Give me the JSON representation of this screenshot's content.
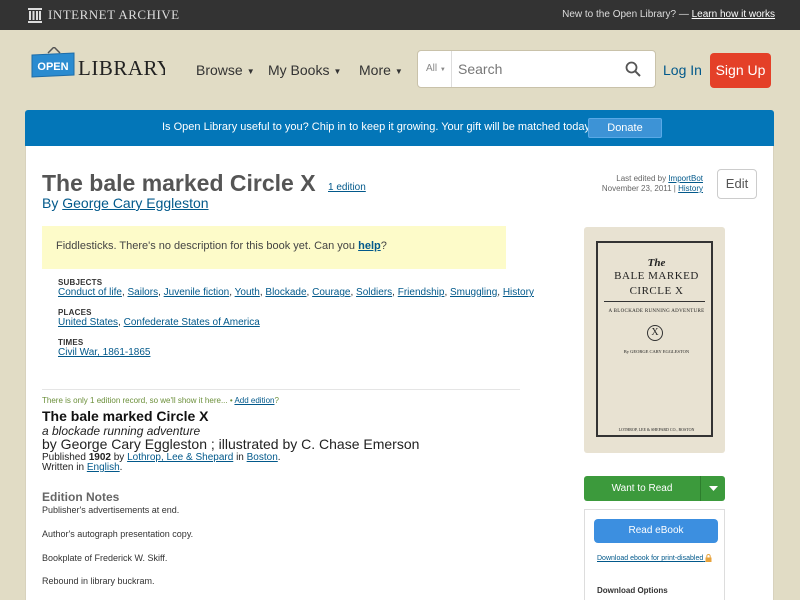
{
  "ia_bar": {
    "logo_text": "INTERNET ARCHIVE",
    "new_text": "New to the Open Library? — ",
    "learn_link": "Learn how it works"
  },
  "header": {
    "logo_open": "OPEN",
    "logo_library": "LIBRARY",
    "nav": [
      {
        "label": "Browse"
      },
      {
        "label": "My Books"
      },
      {
        "label": "More"
      }
    ],
    "search": {
      "category": "All",
      "placeholder": "Search"
    },
    "login": "Log In",
    "signup": "Sign Up"
  },
  "banner": {
    "text": "Is Open Library useful to you? Chip in to keep it growing. Your gift will be matched today!",
    "donate": "Donate"
  },
  "book": {
    "title": "The bale marked Circle X",
    "edition_count": "1 edition",
    "by": "By",
    "author": "George Cary Eggleston",
    "last_edited_label": "Last edited by",
    "last_edited_by": "ImportBot",
    "last_edited_date": "November 23, 2011",
    "history": "History",
    "edit": "Edit"
  },
  "description": {
    "text": "Fiddlesticks. There's no description for this book yet. Can you ",
    "help": "help",
    "end": "?"
  },
  "subjects": {
    "label": "SUBJECTS",
    "items": [
      "Conduct of life",
      "Sailors",
      "Juvenile fiction",
      "Youth",
      "Blockade",
      "Courage",
      "Soldiers",
      "Friendship",
      "Smuggling",
      "History"
    ]
  },
  "places": {
    "label": "PLACES",
    "items": [
      "United States",
      "Confederate States of America"
    ]
  },
  "times": {
    "label": "TIMES",
    "items": [
      "Civil War, 1861-1865"
    ]
  },
  "edition": {
    "only_one": "There is only 1 edition record, so we'll show it here...",
    "add_edition": "Add edition",
    "title": "The bale marked Circle X",
    "subtitle": "a blockade running adventure",
    "by_line": "by George Cary Eggleston ; illustrated by C. Chase Emerson",
    "published_label": "Published",
    "year": "1902",
    "by": "by",
    "publisher": "Lothrop, Lee & Shepard",
    "in": "in",
    "place": "Boston",
    "written_in_label": "Written in",
    "language": "English"
  },
  "notes": {
    "heading": "Edition Notes",
    "items": [
      "Publisher's advertisements at end.",
      "Author's autograph presentation copy.",
      "Bookplate of Frederick W. Skiff.",
      "Rebound in library buckram."
    ]
  },
  "cover": {
    "the": "The",
    "line1": "BALE MARKED",
    "line2": "CIRCLE X",
    "subtitle": "A BLOCKADE RUNNING ADVENTURE",
    "author": "By GEORGE CARY EGGLESTON",
    "publisher": "LOTHROP, LEE & SHEPARD CO., BOSTON"
  },
  "actions": {
    "want_to_read": "Want to Read",
    "read_ebook": "Read eBook",
    "download_print": "Download ebook for print-disabled",
    "download_options": "Download Options"
  }
}
